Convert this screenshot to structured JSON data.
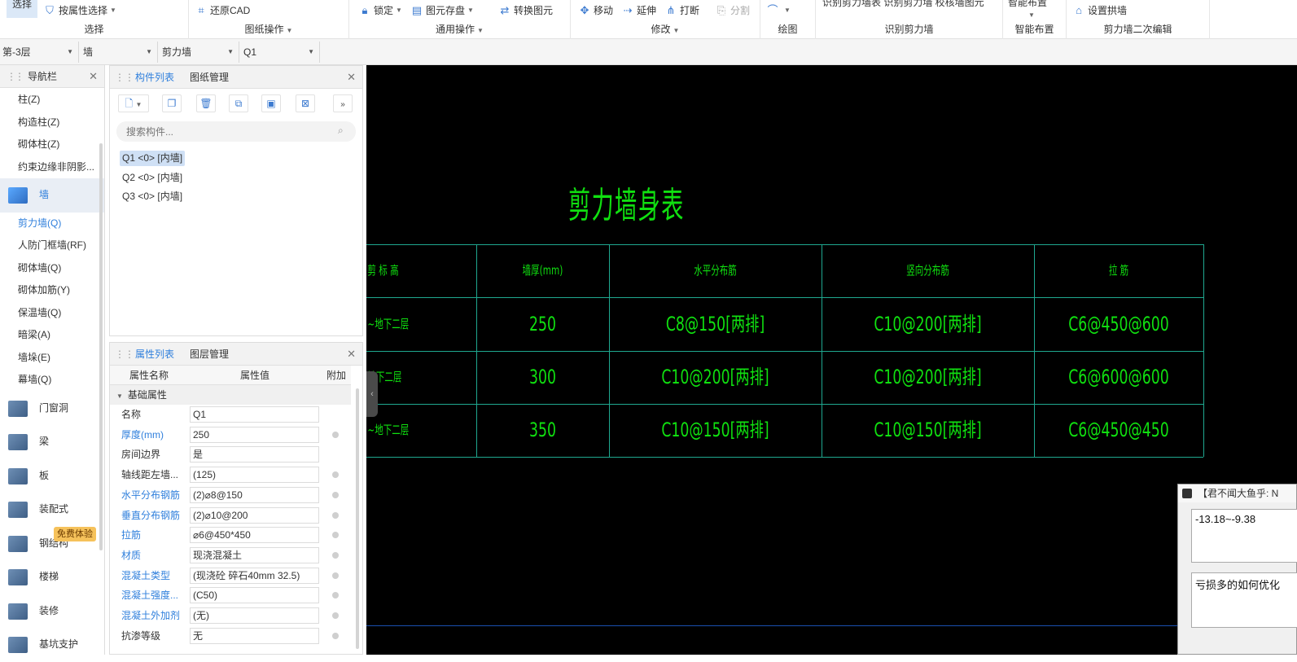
{
  "ribbon": {
    "select_group": {
      "active_label": "选择",
      "by_property": "按属性选择",
      "title": "选择"
    },
    "drawing_ops": {
      "restore_cad": "还原CAD",
      "title": "图纸操作"
    },
    "common_ops": {
      "lock": "锁定",
      "save_element": "图元存盘",
      "convert": "转换图元",
      "title": "通用操作"
    },
    "modify": {
      "move": "移动",
      "extend": "延伸",
      "break": "打断",
      "split": "分割",
      "title": "修改"
    },
    "draw": {
      "title": "绘图"
    },
    "identify": {
      "top_labels": "识别剪力墙表   识别剪力墙   校核墙图元",
      "title": "识别剪力墙"
    },
    "smart": {
      "top_label": "智能布置",
      "title": "智能布置"
    },
    "secondary": {
      "arch_wall": "设置拱墙",
      "title": "剪力墙二次编辑"
    }
  },
  "filterbar": {
    "floor": "第-3层",
    "category": "墙",
    "type": "剪力墙",
    "component": "Q1"
  },
  "nav": {
    "title": "导航栏",
    "sub_top": [
      "柱(Z)",
      "构造柱(Z)",
      "砌体柱(Z)",
      "约束边缘非阴影..."
    ],
    "wall_cat": "墙",
    "wall_items": [
      "剪力墙(Q)",
      "人防门框墙(RF)",
      "砌体墙(Q)",
      "砌体加筋(Y)",
      "保温墙(Q)",
      "暗梁(A)",
      "墙垛(E)",
      "幕墙(Q)"
    ],
    "cats": [
      "门窗洞",
      "梁",
      "板",
      "装配式",
      "钢结构",
      "楼梯",
      "装修",
      "基坑支护"
    ],
    "badge": "免费体验"
  },
  "component_panel": {
    "tab_list": "构件列表",
    "tab_drawing": "图纸管理",
    "search_placeholder": "搜索构件...",
    "items": [
      "Q1 <0> [内墙]",
      "Q2 <0> [内墙]",
      "Q3 <0> [内墙]"
    ]
  },
  "property_panel": {
    "tab_props": "属性列表",
    "tab_layers": "图层管理",
    "col_name": "属性名称",
    "col_value": "属性值",
    "col_extra": "附加",
    "group": "基础属性",
    "rows": [
      {
        "name": "名称",
        "value": "Q1"
      },
      {
        "name": "厚度(mm)",
        "value": "250"
      },
      {
        "name": "房间边界",
        "value": "是"
      },
      {
        "name": "轴线距左墙...",
        "value": "(125)"
      },
      {
        "name": "水平分布钢筋",
        "value": "(2)⌀8@150"
      },
      {
        "name": "垂直分布钢筋",
        "value": "(2)⌀10@200"
      },
      {
        "name": "拉筋",
        "value": "⌀6@450*450"
      },
      {
        "name": "材质",
        "value": "现浇混凝土"
      },
      {
        "name": "混凝土类型",
        "value": "(现浇砼 碎石40mm 32.5)"
      },
      {
        "name": "混凝土强度...",
        "value": "(C50)"
      },
      {
        "name": "混凝土外加剂",
        "value": "(无)"
      },
      {
        "name": "抗渗等级",
        "value": "无"
      }
    ]
  },
  "cad": {
    "title": "剪力墙身表",
    "headers": [
      "剪 标 高",
      "墙厚(mm)",
      "水平分布筋",
      "竖向分布筋",
      "拉 筋"
    ],
    "rows": [
      [
        "~地下二层",
        "250",
        "C8@150[两排]",
        "C10@200[两排]",
        "C6@450@600"
      ],
      [
        "地下二层",
        "300",
        "C10@200[两排]",
        "C10@200[两排]",
        "C6@600@600"
      ],
      [
        "~地下二层",
        "350",
        "C10@150[两排]",
        "C10@150[两排]",
        "C6@450@450"
      ]
    ]
  },
  "float_window": {
    "title": "【君不闻大鱼乎: N",
    "line1": "-13.18~-9.38",
    "line2": "亏损多的如何优化"
  }
}
